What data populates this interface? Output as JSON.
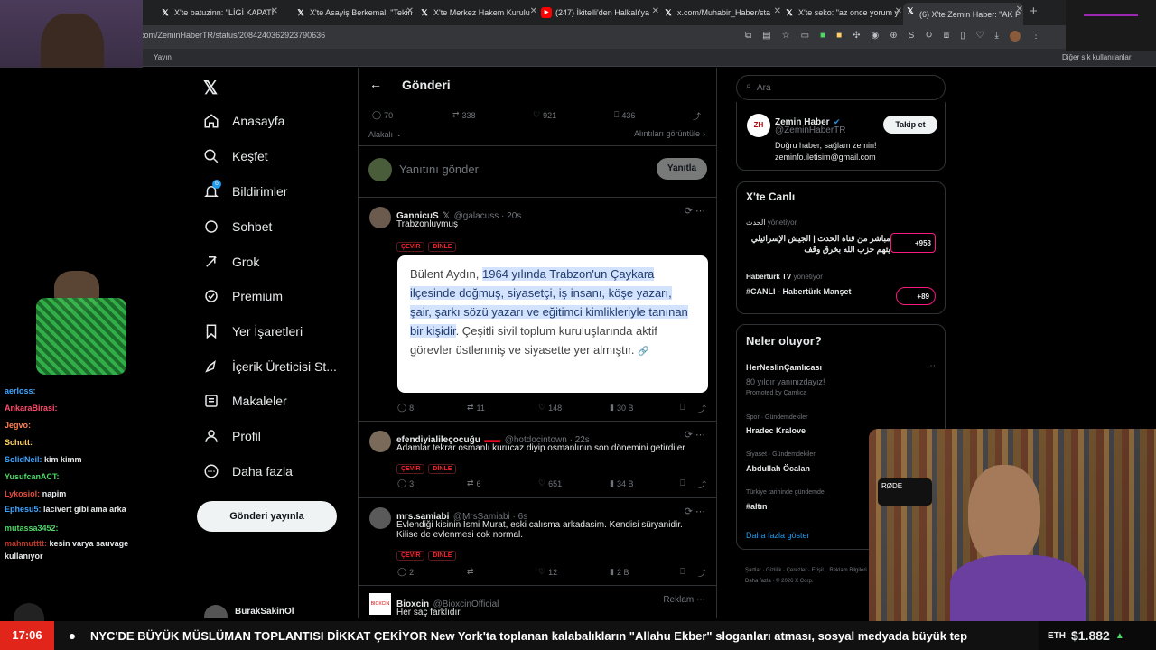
{
  "tabs": [
    {
      "label": "X'te batuzinn: \"LİGİ KAPATI",
      "icon": "x-icon"
    },
    {
      "label": "X'te Asayiş Berkemal: \"Tekin",
      "icon": "x-icon"
    },
    {
      "label": "X'te Merkez Hakem Kurulu",
      "icon": "x-icon"
    },
    {
      "label": "(247) İkitelli'den Halkalı'ya",
      "icon": "youtube-icon"
    },
    {
      "label": "x.com/Muhabir_Haber/sta",
      "icon": "x-icon"
    },
    {
      "label": "X'te seko: \"az once yorum y",
      "icon": "x-icon"
    },
    {
      "label": "(6) X'te Zemin Haber: \"AK P",
      "icon": "x-icon"
    }
  ],
  "address": {
    "url": "com/ZeminHaberTR/status/2084240362923790636"
  },
  "bookmarks": {
    "left": "Yayın",
    "right": "Diğer sık kullanılanlar"
  },
  "nav": {
    "items": [
      "Anasayfa",
      "Keşfet",
      "Bildirimler",
      "Sohbet",
      "Grok",
      "Premium",
      "Yer İşaretleri",
      "İçerik Üreticisi St...",
      "Makaleler",
      "Profil",
      "Daha fazla"
    ],
    "post_button": "Gönderi yayınla",
    "account": "BurakSakinOl",
    "notif_badge": "6"
  },
  "header": {
    "title": "Gönderi"
  },
  "main_stats": {
    "replies": "70",
    "reposts": "338",
    "likes": "921",
    "bookmarks": "436"
  },
  "sort": {
    "left": "Alakalı",
    "right": "Alıntıları görüntüle"
  },
  "reply_box": {
    "placeholder": "Yanıtını gönder",
    "button": "Yanıtla"
  },
  "tweets": [
    {
      "name": "GannicuS",
      "handle": "@galacuss · 20s",
      "text": "Trabzonluymuş",
      "pills": [
        "ÇEVİR",
        "DİNLE"
      ],
      "replies": "8",
      "reposts": "11",
      "likes": "148",
      "views": "30 B"
    },
    {
      "name": "efendiyialileçocuğu",
      "handle": "@hotdocintown · 22s",
      "text": "Adamlar tekrar osmanlı kurucaz diyip osmanlının son dönemini getirdiler",
      "pills": [
        "ÇEVİR",
        "DİNLE"
      ],
      "replies": "3",
      "reposts": "6",
      "likes": "651",
      "views": "34 B"
    },
    {
      "name": "mrs.samiabi",
      "handle": "@MrsSamiabi · 6s",
      "text": "Evlendiği kisinin İsmi Murat, eski calısma arkadasim. Kendisi süryanidir. Kilise de evlenmesi cok normal.",
      "pills": [
        "ÇEVİR",
        "DİNLE"
      ],
      "replies": "2",
      "reposts": "",
      "likes": "12",
      "views": "2 B"
    },
    {
      "name": "Bioxcin",
      "handle": "@BioxcinOfficial",
      "text": "Her saç farklıdır.",
      "ad": "Reklam"
    }
  ],
  "quote_card": {
    "plain_start": "Bülent Aydın, ",
    "highlight": "1964 yılında Trabzon'un Çaykara ilçesinde doğmuş, siyasetçi, iş insanı, köşe yazarı, şair, şarkı sözü yazarı ve eğitimci kimlikleriyle tanınan bir kişidir",
    "plain_end": ". Çeşitli sivil toplum kuruluşlarında aktif görevler üstlenmiş ve siyasette yer almıştır."
  },
  "search": {
    "placeholder": "Ara"
  },
  "profile_card": {
    "name": "Zemin Haber",
    "handle": "@ZeminHaberTR",
    "bio": "Doğru haber, sağlam zemin!\nzeminfo.iletisim@gmail.com",
    "follow": "Takip et"
  },
  "live": {
    "title": "X'te Canlı",
    "items": [
      {
        "host": "الحدث",
        "role": "yönetiyor",
        "text": "مباشر من قناة الحدث | الجيش الإسرائيلي يتهم حزب الله بخرق وقف",
        "count": "+953"
      },
      {
        "host": "Habertürk TV",
        "role": "yönetiyor",
        "text": "#CANLI - Habertürk Manşet",
        "count": "+89"
      }
    ]
  },
  "trends": {
    "title": "Neler oluyor?",
    "items": [
      {
        "name": "HerNeslinÇamlıcası",
        "sub": "80 yıldır yanınızdayız!",
        "meta": "Promoted by Çamlıca"
      },
      {
        "meta": "Spor · Gündemdekiler",
        "name": "Hradec Kralove"
      },
      {
        "meta": "Siyaset · Gündemdekiler",
        "name": "Abdullah Öcalan"
      },
      {
        "meta": "Türkiye tarihinde gündemde",
        "name": "#altın"
      }
    ],
    "more": "Daha fazla göster",
    "footer": "Şartlar · Gizlilik · Çerezler · Erişil... Reklam Bilgileri · Daha fazla · © 2026 X Corp."
  },
  "chat": [
    {
      "user": "aerloss:",
      "msg": "",
      "color": "#3ea6ff"
    },
    {
      "user": "AnkaraBirasi:",
      "msg": "",
      "color": "#ff4d6d"
    },
    {
      "user": "Jegvo:",
      "msg": "",
      "color": "#ff7f50"
    },
    {
      "user": "Schutt:",
      "msg": "",
      "color": "#ffd166"
    },
    {
      "user": "SolidNeil:",
      "msg": "kim kimm",
      "color": "#3ea6ff"
    },
    {
      "user": "YusufcanACT:",
      "msg": "",
      "color": "#4cd964"
    },
    {
      "user": "Lykosiol:",
      "msg": "napim",
      "color": "#e74c3c"
    },
    {
      "user": "Ephesu5:",
      "msg": "lacivert gibi ama arka",
      "color": "#3ea6ff"
    },
    {
      "user": "mutassa3452:",
      "msg": "",
      "color": "#4cd964"
    },
    {
      "user": "mahmutttt:",
      "msg": "kesin varya sauvage kullanıyor",
      "color": "#c0392b"
    }
  ],
  "ticker": {
    "time": "17:06",
    "text": "NYC'DE BÜYÜK MÜSLÜMAN TOPLANTISI DİKKAT ÇEKİYOR New York'ta toplanan kalabalıkların \"Allahu Ekber\" sloganları atması, sosyal medyada büyük tep",
    "coin": "ETH",
    "price": "$1.882"
  },
  "colors": {
    "accent": "#1d9bf0",
    "ticker_time": "#e1251b"
  }
}
